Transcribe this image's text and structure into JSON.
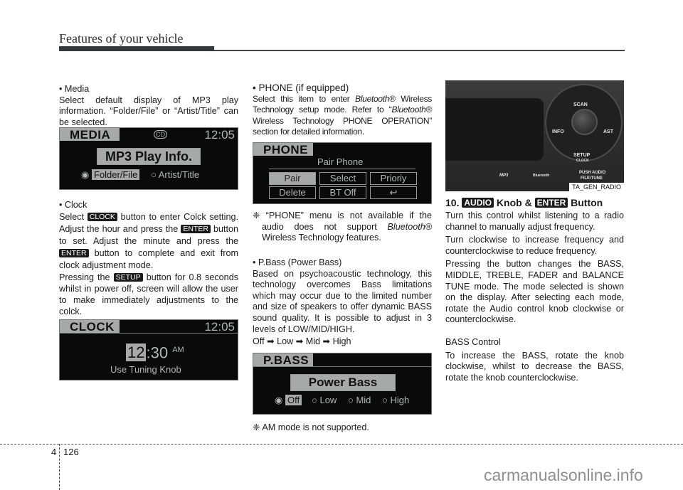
{
  "header": {
    "title": "Features of your vehicle"
  },
  "col1": {
    "media_bullet": "• Media",
    "media_text": "Select default display of MP3 play information. “Folder/File” or “Artist/Title” can be selected.",
    "media_screen": {
      "title": "MEDIA",
      "cd_icon": "CD",
      "time": "12:05",
      "menu": "MP3 Play Info.",
      "options": [
        {
          "label": "Folder/File",
          "selected": true
        },
        {
          "label": "Artist/Title",
          "selected": false
        }
      ]
    },
    "clock_bullet": "• Clock",
    "clock_text": {
      "t1": "Select ",
      "tag_clock": "CLOCK",
      "t2": " button to enter Colck setting. Adjust the hour and press the ",
      "tag_enter1": "ENTER",
      "t3": " button to set. Adjust the minute and press the ",
      "tag_enter2": "ENTER",
      "t4": " button to complete and exit from clock adjustment mode.",
      "t5": "Pressing the ",
      "tag_setup": "SETUP",
      "t6": " button for 0.8 seconds whilst in power off, screen will allow the user to make immediately adjustments to the colck."
    },
    "clock_screen": {
      "title": "CLOCK",
      "time": "12:05",
      "hour": "12",
      "sep": ":",
      "minute": "30",
      "ampm": "AM",
      "hint": "Use Tuning Knob"
    }
  },
  "col2": {
    "phone_bullet": "• PHONE (if equipped)",
    "phone_text": {
      "t1": "Select this item to enter ",
      "bt1": "Bluetooth®",
      "t2": " Wireless Technology setup mode. Refer to “",
      "bt2": "Bluetooth®",
      "t3": " Wireless Technology PHONE OPERATION” section for detailed information."
    },
    "phone_screen": {
      "title": "PHONE",
      "menu": "Pair Phone",
      "buttons": [
        "Pair",
        "Select",
        "Prioriy",
        "Delete",
        "BT Off",
        "↩"
      ]
    },
    "phone_note": {
      "mark": "❈",
      "t1": "“PHONE” menu is not available if the audio does not support ",
      "bt": "Bluetooth®",
      "t2": " Wireless Technology features."
    },
    "pbass_bullet": "• P.Bass (Power Bass)",
    "pbass_text": "Based on psychoacoustic technology, this technology overcomes Bass limitations which may occur due to the limited number and size of speakers to offer dynamic BASS sound quality. It is possible to adjust in 3 levels of LOW/MID/HIGH.",
    "pbass_sequence": "Off ➡ Low ➡ Mid ➡ High",
    "pbass_screen": {
      "title": "P.BASS",
      "menu": "Power Bass",
      "options": [
        {
          "label": "Off",
          "selected": true
        },
        {
          "label": "Low",
          "selected": false
        },
        {
          "label": "Mid",
          "selected": false
        },
        {
          "label": "High",
          "selected": false
        }
      ]
    },
    "am_note": "❈ AM mode is not supported."
  },
  "col3": {
    "photo": {
      "labels": {
        "scan": "SCAN",
        "info": "INFO",
        "ast": "AST",
        "setup": "SETUP",
        "clock": "CLOCK",
        "push": "PUSH AUDIO",
        "file": "FILE/TUNE",
        "mp3": "MP3",
        "bt": "Bluetooth"
      },
      "caption": "TA_GEN_RADIO"
    },
    "heading": {
      "num": "10. ",
      "tag_audio": "AUDIO",
      "mid": " Knob & ",
      "tag_enter": "ENTER",
      "end": " Button"
    },
    "p1": "Turn this control whilst listening to a radio channel to manually adjust frequency.",
    "p2": "Turn clockwise to increase frequency and counterclockwise to reduce frequency.",
    "p3": "Pressing the button changes the BASS, MIDDLE, TREBLE, FADER and BALANCE TUNE mode. The mode selected is shown on the display. After selecting each mode, rotate the Audio control knob clockwise or counterclockwise.",
    "bass_heading": "BASS Control",
    "p4": "To increase the BASS, rotate the knob clockwise, whilst to decrease the BASS, rotate the knob counterclockwise."
  },
  "footer": {
    "chapter": "4",
    "page": "126",
    "watermark": "carmanualsonline.info"
  }
}
